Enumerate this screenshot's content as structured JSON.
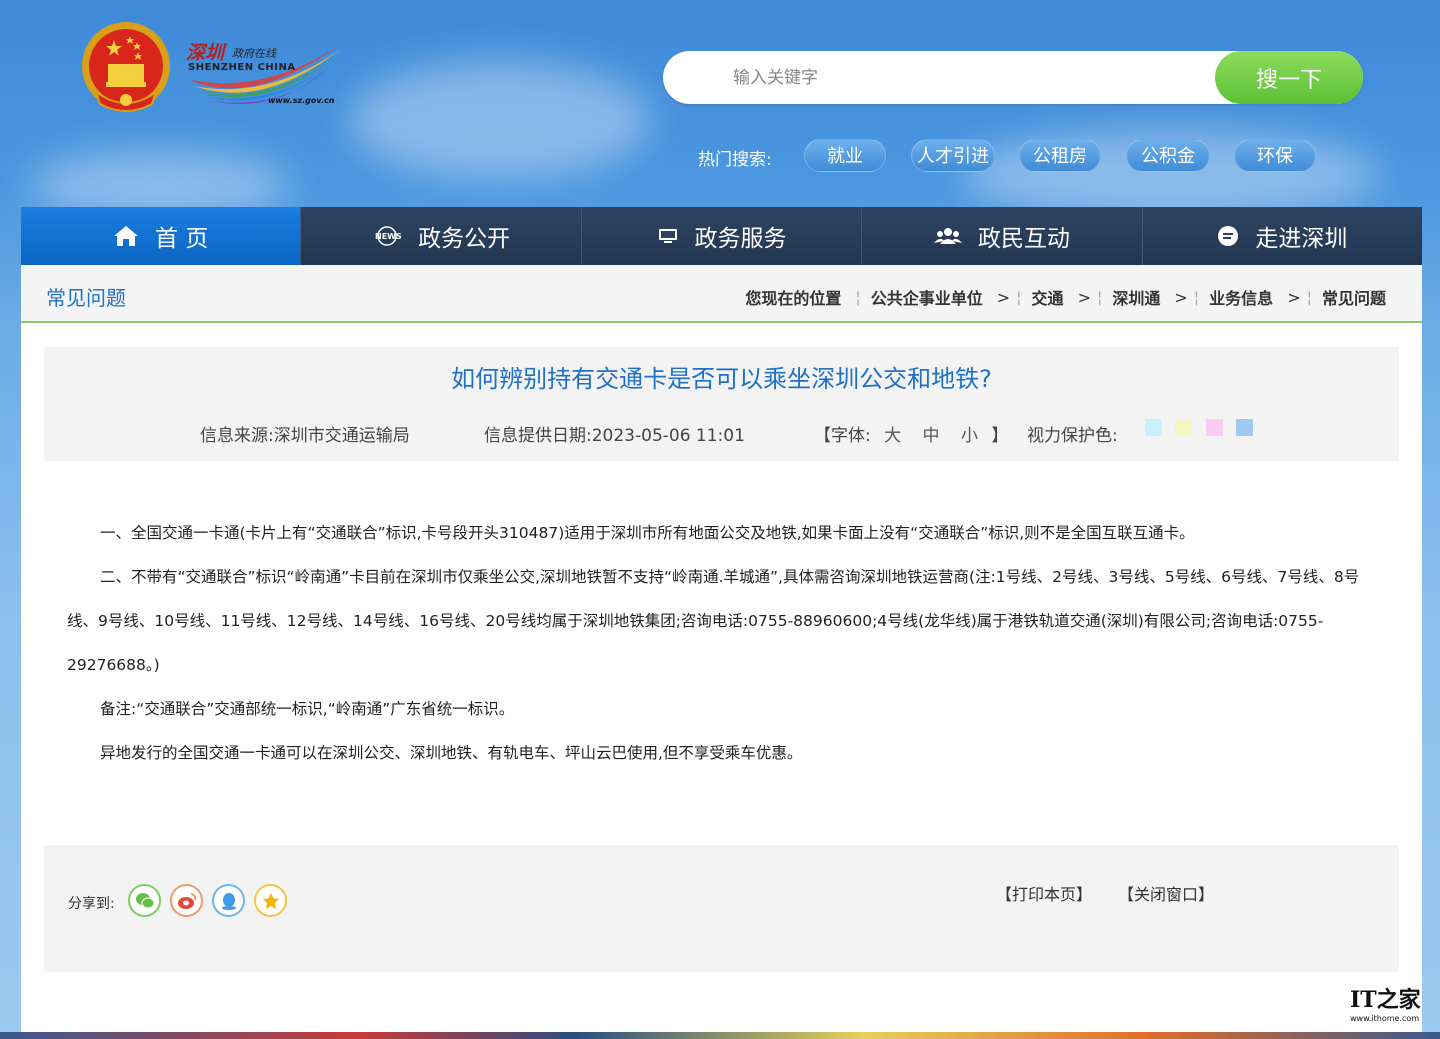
{
  "header": {
    "logo": {
      "cn": "深圳",
      "cn_sub": "政府在线",
      "en": "SHENZHEN CHINA",
      "url": "www.sz.gov.cn"
    },
    "search": {
      "placeholder": "输入关键字",
      "button_label": "搜一下"
    },
    "hot_search": {
      "label": "热门搜索:",
      "tags": [
        "就业",
        "人才引进",
        "公租房",
        "公积金",
        "环保"
      ]
    }
  },
  "nav": {
    "items": [
      {
        "label": "首 页",
        "icon": "home-icon"
      },
      {
        "label": "政务公开",
        "icon": "news-icon"
      },
      {
        "label": "政务服务",
        "icon": "monitor-icon"
      },
      {
        "label": "政民互动",
        "icon": "users-icon"
      },
      {
        "label": "走进深圳",
        "icon": "info-icon"
      }
    ]
  },
  "breadcrumb": {
    "section_title": "常见问题",
    "prefix": "您现在的位置",
    "items": [
      "公共企事业单位",
      "交通",
      "深圳通",
      "业务信息",
      "常见问题"
    ],
    "separator": ">"
  },
  "article": {
    "title": "如何辨别持有交通卡是否可以乘坐深圳公交和地铁?",
    "source": "信息来源:深圳市交通运输局",
    "date": "信息提供日期:2023-05-06 11:01",
    "font_size_open": "【字体:",
    "font_sizes": [
      "大",
      "中",
      "小"
    ],
    "font_size_close": "】",
    "eye_care_label": "视力保护色:",
    "eye_care_colors": [
      "#c9f1fb",
      "#f7f3c2",
      "#f8cbf2",
      "#9fc9f2"
    ],
    "paragraphs": [
      "一、全国交通一卡通(卡片上有“交通联合”标识,卡号段开头310487)适用于深圳市所有地面公交及地铁,如果卡面上没有“交通联合”标识,则不是全国互联互通卡。",
      "二、不带有“交通联合”标识“岭南通”卡目前在深圳市仅乘坐公交,深圳地铁暂不支持“岭南通.羊城通”,具体需咨询深圳地铁运营商(注:1号线、2号线、3号线、5号线、6号线、7号线、8号线、9号线、10号线、11号线、12号线、14号线、16号线、20号线均属于深圳地铁集团;咨询电话:0755-88960600;4号线(龙华线)属于港铁轨道交通(深圳)有限公司;咨询电话:0755-29276688。)",
      "备注:“交通联合”交通部统一标识,“岭南通”广东省统一标识。",
      "异地发行的全国交通一卡通可以在深圳公交、深圳地铁、有轨电车、坪山云巴使用,但不享受乘车优惠。"
    ]
  },
  "footer": {
    "share_label": "分享到:",
    "share_icons": [
      "wechat-icon",
      "weibo-icon",
      "qq-icon",
      "qzone-icon"
    ],
    "print_label": "【打印本页】",
    "close_label": "【关闭窗口】"
  },
  "watermark": {
    "big": "IT之家",
    "small": "www.ithome.com"
  },
  "colors": {
    "accent_blue": "#1e70c9",
    "nav_dark": "#2a4160",
    "nav_active": "#0b66c5",
    "search_green": "#5cc037",
    "divider_green": "#7fcf6a"
  }
}
